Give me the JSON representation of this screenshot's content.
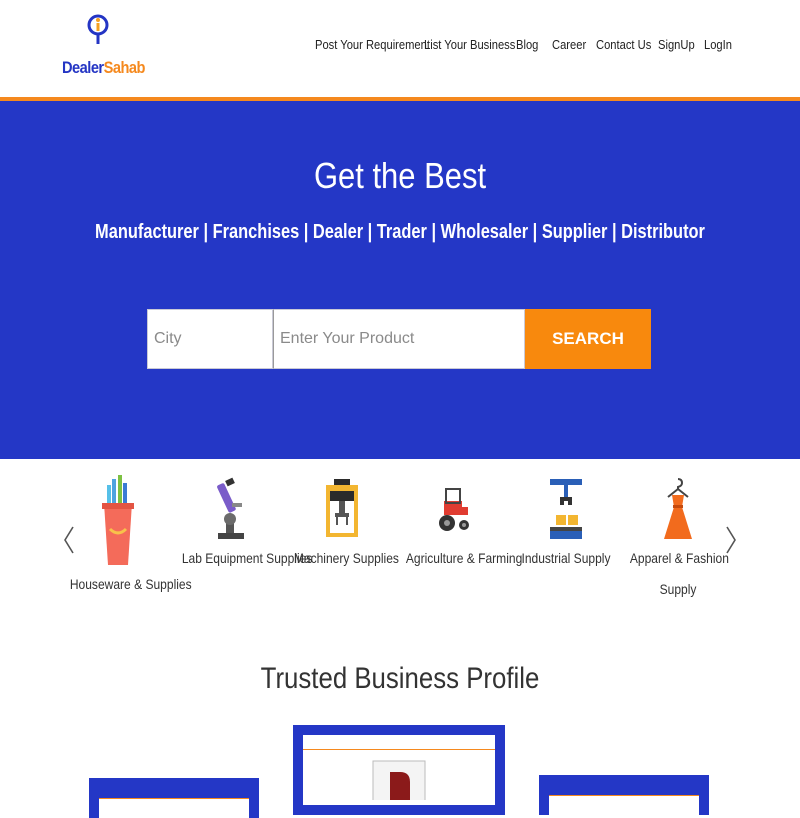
{
  "header": {
    "logo": {
      "part1": "Dealer",
      "part2": "Sahab"
    },
    "nav": [
      {
        "label": "Post Your Requirement"
      },
      {
        "label": "List Your Business"
      },
      {
        "label": "Blog"
      },
      {
        "label": "Career"
      },
      {
        "label": "Contact Us"
      },
      {
        "label": "SignUp"
      },
      {
        "label": "LogIn"
      }
    ]
  },
  "hero": {
    "title": "Get the Best",
    "subtitle": "Manufacturer | Franchises | Dealer | Trader | Wholesaler | Supplier | Distributor",
    "search": {
      "city_placeholder": "City",
      "product_placeholder": "Enter Your Product",
      "button_label": "SEARCH"
    }
  },
  "categories": [
    {
      "label_lines": [
        "Houseware & Supplies"
      ],
      "icon": "bucket-icon"
    },
    {
      "label_lines": [
        "Lab Equipment Supplies"
      ],
      "icon": "microscope-icon"
    },
    {
      "label_lines": [
        "Machinery Supplies"
      ],
      "icon": "machine-icon"
    },
    {
      "label_lines": [
        "Agriculture & Farming"
      ],
      "icon": "tractor-icon"
    },
    {
      "label_lines": [
        "Industrial Supply"
      ],
      "icon": "conveyor-icon"
    },
    {
      "label_lines": [
        "Apparel & Fashion",
        "Supply"
      ],
      "icon": "dress-icon"
    }
  ],
  "trusted": {
    "title": "Trusted Business Profile"
  },
  "colors": {
    "brand_blue": "#2437c6",
    "brand_orange": "#f5891e"
  }
}
